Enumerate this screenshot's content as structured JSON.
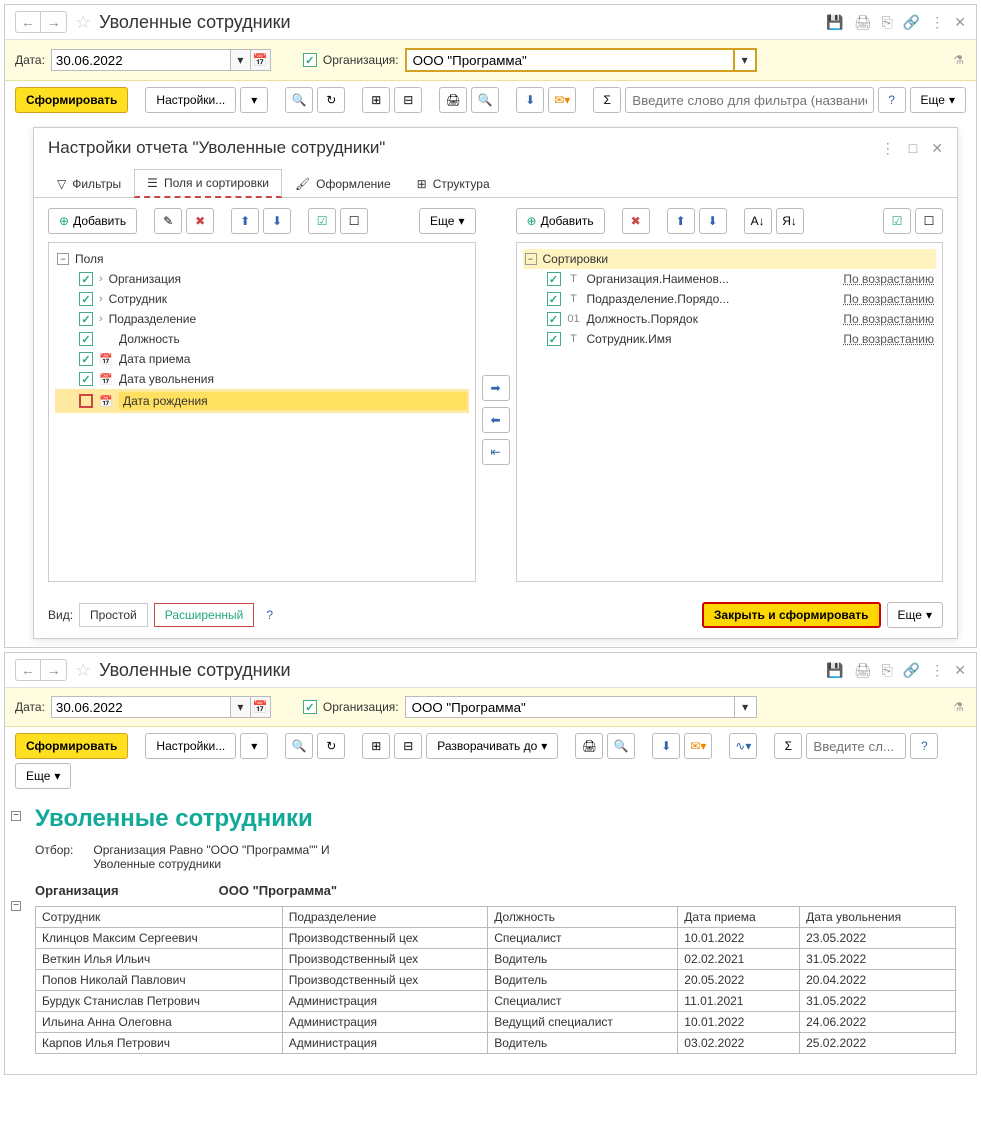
{
  "top": {
    "title": "Уволенные сотрудники",
    "date_label": "Дата:",
    "date_value": "30.06.2022",
    "org_label": "Организация:",
    "org_value": "ООО \"Программа\"",
    "form_btn": "Сформировать",
    "settings_btn": "Настройки...",
    "search_placeholder": "Введите слово для фильтра (название товар...",
    "more_btn": "Еще"
  },
  "dlg": {
    "title": "Настройки отчета \"Уволенные сотрудники\"",
    "tabs": {
      "filters": "Фильтры",
      "fields": "Поля и сортировки",
      "format": "Оформление",
      "struct": "Структура"
    },
    "add_btn": "Добавить",
    "more_btn": "Еще",
    "fields_hdr": "Поля",
    "fields": [
      {
        "checked": true,
        "expandable": true,
        "name": "Организация"
      },
      {
        "checked": true,
        "expandable": true,
        "name": "Сотрудник"
      },
      {
        "checked": true,
        "expandable": true,
        "name": "Подразделение"
      },
      {
        "checked": true,
        "expandable": false,
        "name": "Должность"
      },
      {
        "checked": true,
        "type": "date",
        "name": "Дата приема"
      },
      {
        "checked": true,
        "type": "date",
        "name": "Дата увольнения"
      },
      {
        "checked": false,
        "type": "date",
        "name": "Дата рождения",
        "selected": true
      }
    ],
    "sort_hdr": "Сортировки",
    "sorts": [
      {
        "type": "T",
        "name": "Организация.Наименов...",
        "order": "По возрастанию"
      },
      {
        "type": "T",
        "name": "Подразделение.Порядо...",
        "order": "По возрастанию"
      },
      {
        "type": "01",
        "name": "Должность.Порядок",
        "order": "По возрастанию"
      },
      {
        "type": "T",
        "name": "Сотрудник.Имя",
        "order": "По возрастанию"
      }
    ],
    "view_label": "Вид:",
    "view_simple": "Простой",
    "view_ext": "Расширенный",
    "close_form_btn": "Закрыть и сформировать",
    "more": "Еще"
  },
  "bottom": {
    "title": "Уволенные сотрудники",
    "date_label": "Дата:",
    "date_value": "30.06.2022",
    "org_label": "Организация:",
    "org_value": "ООО \"Программа\"",
    "form_btn": "Сформировать",
    "settings_btn": "Настройки...",
    "expand_btn": "Разворачивать до",
    "search_placeholder": "Введите сл...",
    "more_btn": "Еще"
  },
  "report": {
    "title": "Уволенные сотрудники",
    "filter_label": "Отбор:",
    "filter_text1": "Организация Равно \"ООО \"Программа\"\" И",
    "filter_text2": "Уволенные сотрудники",
    "org_hdr": "Организация",
    "org_val": "ООО \"Программа\"",
    "cols": {
      "emp": "Сотрудник",
      "dept": "Подразделение",
      "pos": "Должность",
      "hire": "Дата приема",
      "fire": "Дата увольнения"
    },
    "rows": [
      {
        "emp": "Клинцов Максим Сергеевич",
        "dept": "Производственный цех",
        "pos": "Специалист",
        "hire": "10.01.2022",
        "fire": "23.05.2022"
      },
      {
        "emp": "Веткин Илья Ильич",
        "dept": "Производственный цех",
        "pos": "Водитель",
        "hire": "02.02.2021",
        "fire": "31.05.2022"
      },
      {
        "emp": "Попов Николай Павлович",
        "dept": "Производственный цех",
        "pos": "Водитель",
        "hire": "20.05.2022",
        "fire": "20.04.2022"
      },
      {
        "emp": "Бурдук Станислав Петрович",
        "dept": "Администрация",
        "pos": "Специалист",
        "hire": "11.01.2021",
        "fire": "31.05.2022"
      },
      {
        "emp": "Ильина Анна Олеговна",
        "dept": "Администрация",
        "pos": "Ведущий специалист",
        "hire": "10.01.2022",
        "fire": "24.06.2022"
      },
      {
        "emp": "Карпов Илья Петрович",
        "dept": "Администрация",
        "pos": "Водитель",
        "hire": "03.02.2022",
        "fire": "25.02.2022"
      }
    ]
  }
}
